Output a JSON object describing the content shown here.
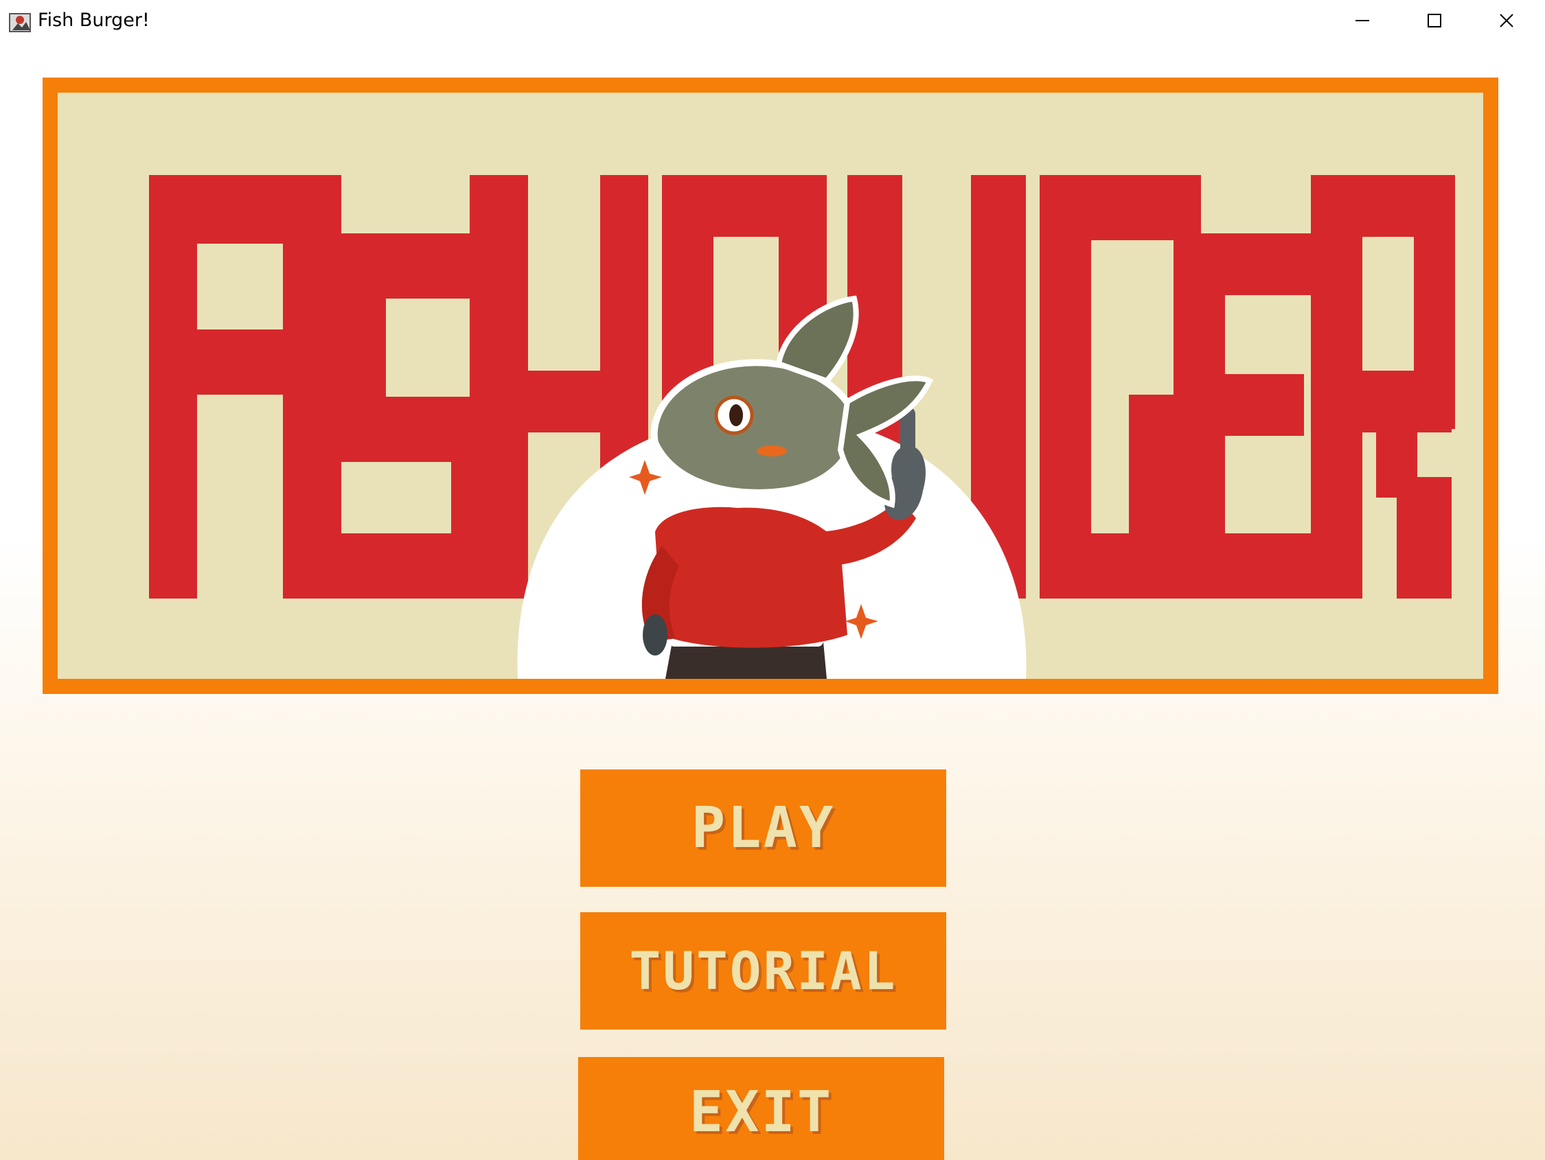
{
  "window": {
    "title": "Fish Burger!",
    "controls": [
      "minimize",
      "maximize",
      "close"
    ]
  },
  "banner": {
    "logo_text": "FISHBURGER",
    "colors": {
      "frame": "#f57f08",
      "panel": "#e9e2b8",
      "logo": "#d6282c"
    }
  },
  "menu": {
    "play_label": "PLAY",
    "tutorial_label": "TUTORIAL",
    "exit_label": "EXIT",
    "button_color": "#f57f08",
    "label_color": "#efe2ad"
  }
}
